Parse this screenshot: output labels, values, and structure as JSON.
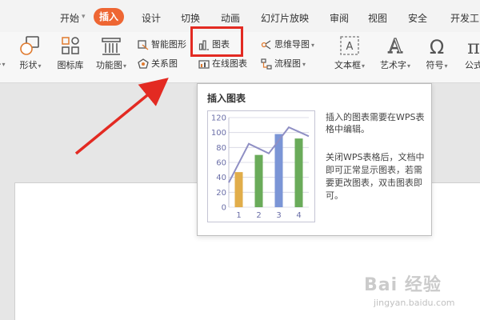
{
  "tabs": [
    {
      "label": "开始",
      "active": false
    },
    {
      "label": "插入",
      "active": true
    },
    {
      "label": "设计",
      "active": false
    },
    {
      "label": "切换",
      "active": false
    },
    {
      "label": "动画",
      "active": false
    },
    {
      "label": "幻灯片放映",
      "active": false
    },
    {
      "label": "审阅",
      "active": false
    },
    {
      "label": "视图",
      "active": false
    },
    {
      "label": "安全",
      "active": false
    },
    {
      "label": "开发工",
      "active": false
    }
  ],
  "ribbon": {
    "shape_label": "形状",
    "icon_library_label": "图标库",
    "function_chart_label": "功能图",
    "smart_shape_label": "智能图形",
    "relation_chart_label": "关系图",
    "chart_label": "图表",
    "online_chart_label": "在线图表",
    "mind_map_label": "思维导图",
    "flowchart_label": "流程图",
    "textbox_label": "文本框",
    "art_text_label": "艺术字",
    "symbol_label": "符号",
    "formula_label": "公式",
    "left_cut_label": "-"
  },
  "tooltip": {
    "title": "插入图表",
    "desc_line1": "插入的图表需要在WPS表格中编辑。",
    "desc_line2": "关闭WPS表格后，文档中即可正常显示图表，若需要更改图表，双击图表即可。"
  },
  "chart_data": {
    "type": "bar",
    "categories": [
      "1",
      "2",
      "3",
      "4"
    ],
    "values": [
      47,
      70,
      98,
      92
    ],
    "line_values": [
      33,
      85,
      72,
      107,
      95
    ],
    "ylim": [
      0,
      120
    ],
    "yticks": [
      "0",
      "20",
      "40",
      "60",
      "80",
      "100",
      "120"
    ],
    "bar_colors": [
      "#e1ad4a",
      "#6aab5a",
      "#7b95d6",
      "#6aab5a"
    ],
    "line_color": "#8f8fc4"
  },
  "watermark": {
    "text": "Bai 经验",
    "url": "jingyan.baidu.com"
  }
}
